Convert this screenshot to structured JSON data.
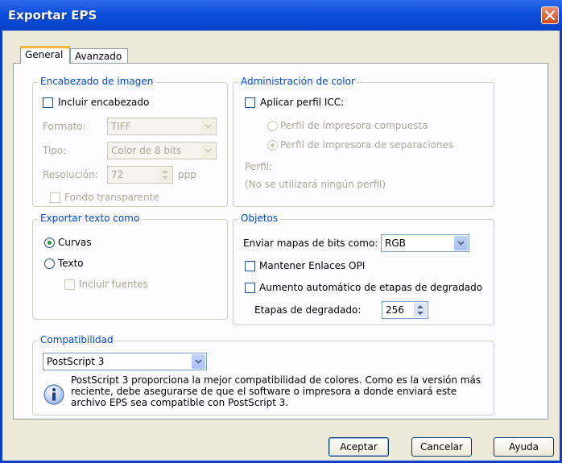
{
  "window": {
    "title": "Exportar EPS"
  },
  "tabs": [
    {
      "label": "General"
    },
    {
      "label": "Avanzado"
    }
  ],
  "header_group": {
    "legend": "Encabezado de imagen",
    "include_header": "Incluir encabezado",
    "format_label": "Formato:",
    "format_value": "TIFF",
    "type_label": "Tipo:",
    "type_value": "Color de 8 bits",
    "resolution_label": "Resolución:",
    "resolution_value": "72",
    "resolution_unit": "ppp",
    "transparent_bg": "Fondo transparente"
  },
  "color_group": {
    "legend": "Administración de color",
    "apply_icc": "Aplicar perfil ICC:",
    "composite": "Perfil de impresora compuesta",
    "separations": "Perfil de impresora de separaciones",
    "profile_label": "Perfil:",
    "profile_value": "(No se utilizará ningún perfil)"
  },
  "export_text_group": {
    "legend": "Exportar texto como",
    "curves": "Curvas",
    "text": "Texto",
    "include_fonts": "Incluir fuentes"
  },
  "objects_group": {
    "legend": "Objetos",
    "bitmaps_label": "Enviar mapas de bits como:",
    "bitmaps_value": "RGB",
    "keep_opi": "Mantener Enlaces OPI",
    "auto_steps": "Aumento automático de etapas de degradado",
    "steps_label": "Etapas de degradado:",
    "steps_value": "256"
  },
  "compat_group": {
    "legend": "Compatibilidad",
    "value": "PostScript 3",
    "info_line1": "PostScript 3 proporciona la mejor compatibilidad de colores. Como es la versión más",
    "info_line2": "reciente, debe asegurarse de que el software o impresora a donde enviará este",
    "info_line3": "archivo EPS sea compatible con PostScript 3."
  },
  "buttons": {
    "ok": "Aceptar",
    "cancel": "Cancelar",
    "help": "Ayuda"
  }
}
